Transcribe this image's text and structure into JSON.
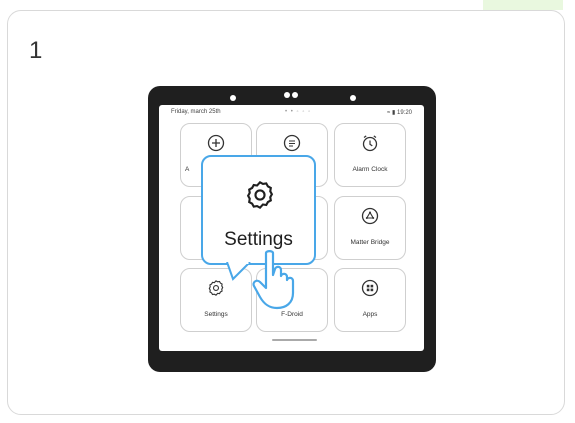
{
  "step_number": "1",
  "status_bar": {
    "date": "Friday, march 25th",
    "page_dots": "• • ◦ ◦ ◦",
    "status_right": "≈ ▮ 19:20"
  },
  "tiles": [
    {
      "label": "A",
      "icon": "plus-circle-icon"
    },
    {
      "label": "",
      "icon": "widget-icon"
    },
    {
      "label": "Alarm Clock",
      "icon": "alarm-clock-icon"
    },
    {
      "label": "",
      "icon": ""
    },
    {
      "label": "",
      "icon": ""
    },
    {
      "label": "Matter Bridge",
      "icon": "matter-bridge-icon"
    },
    {
      "label": "Settings",
      "icon": "gear-icon"
    },
    {
      "label": "F-Droid",
      "icon": ""
    },
    {
      "label": "Apps",
      "icon": "apps-icon"
    }
  ],
  "popup": {
    "label": "Settings",
    "icon": "gear-icon"
  },
  "colors": {
    "accent": "#49a7e8",
    "device": "#1f1f1f",
    "tile_border": "#cfcfcf",
    "corner_tab": "#e9f8df"
  }
}
